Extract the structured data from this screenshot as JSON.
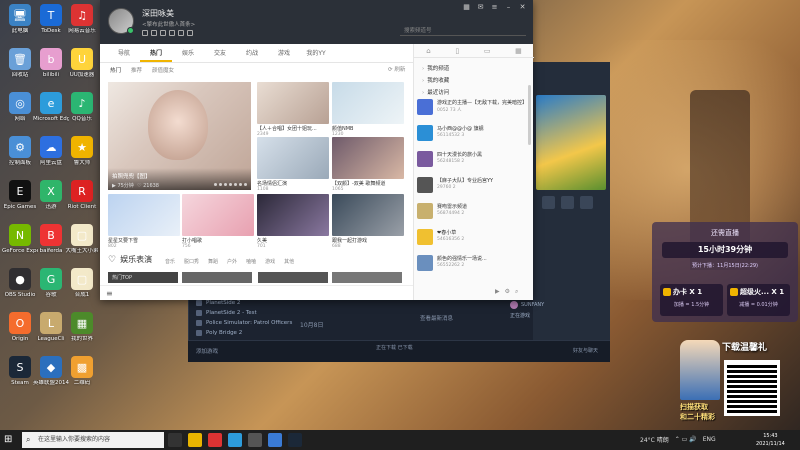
{
  "desktop": {
    "icons": [
      {
        "label": "此电脑",
        "color": "#3b82c4",
        "glyph": "🖥"
      },
      {
        "label": "ToDesk",
        "color": "#1a6ad6",
        "glyph": "T"
      },
      {
        "label": "网易云音乐",
        "color": "#d33",
        "glyph": "♫"
      },
      {
        "label": "回收站",
        "color": "#6aa0d8",
        "glyph": "🗑"
      },
      {
        "label": "bilibili",
        "color": "#e79ecf",
        "glyph": "b"
      },
      {
        "label": "UU加速器",
        "color": "#ffd43b",
        "glyph": "U"
      },
      {
        "label": "网络",
        "color": "#4a8fd6",
        "glyph": "◎"
      },
      {
        "label": "Microsoft Edge",
        "color": "#2d9cdb",
        "glyph": "e"
      },
      {
        "label": "QQ音乐",
        "color": "#2bb673",
        "glyph": "♪"
      },
      {
        "label": "控制面板",
        "color": "#4a8fd6",
        "glyph": "⚙"
      },
      {
        "label": "阿里云盘",
        "color": "#2d6fe0",
        "glyph": "☁"
      },
      {
        "label": "鲁大师",
        "color": "#f0b400",
        "glyph": "★"
      },
      {
        "label": "Epic Games",
        "color": "#111",
        "glyph": "E"
      },
      {
        "label": "迅游",
        "color": "#2fb56a",
        "glyph": "X"
      },
      {
        "label": "Riot Client",
        "color": "#d22",
        "glyph": "R"
      },
      {
        "label": "GeForce Experience",
        "color": "#76b900",
        "glyph": "N"
      },
      {
        "label": "baiferda",
        "color": "#e33",
        "glyph": "B"
      },
      {
        "label": "大嘴王大小弟",
        "color": "#f3e9c9",
        "glyph": "▢"
      },
      {
        "label": "OBS Studio",
        "color": "#302e31",
        "glyph": "●"
      },
      {
        "label": "谷歌",
        "color": "#2bb673",
        "glyph": "G"
      },
      {
        "label": "合成1",
        "color": "#f3e9c9",
        "glyph": "▢"
      },
      {
        "label": "Origin",
        "color": "#f56c2d",
        "glyph": "O"
      },
      {
        "label": "LeagueCli",
        "color": "#c8aa6e",
        "glyph": "L"
      },
      {
        "label": "我的世界",
        "color": "#4c8a2a",
        "glyph": "▦"
      },
      {
        "label": "Steam",
        "color": "#1b2838",
        "glyph": "S"
      },
      {
        "label": "英雄联盟2014",
        "color": "#2b6fbd",
        "glyph": "◆"
      },
      {
        "label": "二维码",
        "color": "#f0a030",
        "glyph": "▩"
      }
    ]
  },
  "yy": {
    "user_name": "深田咏美",
    "signature": "<擎布此世傲人首条>",
    "search_placeholder": "搜索频道号",
    "nav_tabs": [
      "导航",
      "热门",
      "娱乐",
      "交友",
      "约战",
      "游戏",
      "我的YY"
    ],
    "active_tab": "热门",
    "subnav": [
      "热门",
      "推荐",
      "颜值魔女"
    ],
    "refresh_label": "刷新",
    "featured": {
      "title": "拍照兜兜【图】",
      "viewers": "75分钟",
      "count": "21638"
    },
    "tiles": [
      {
        "title": "【人＋合唱】女团十姐玩...",
        "meta": "2349"
      },
      {
        "title": "颜值NMB",
        "meta": "1230"
      },
      {
        "title": "名场情侣汇演",
        "meta": "1108"
      },
      {
        "title": "【双颜】-双美 歌舞频道",
        "meta": "1065"
      },
      {
        "title": "星星又要下雪",
        "meta": "802"
      },
      {
        "title": "打小唱歌",
        "meta": "756"
      },
      {
        "title": "久美",
        "meta": "701"
      },
      {
        "title": "跟我一起打游戏",
        "meta": "688"
      }
    ],
    "section_title": "娱乐表演",
    "section_cats": [
      "音乐",
      "脱口秀",
      "舞蹈",
      "户外",
      "嗑嗑",
      "游戏",
      "其他"
    ],
    "hot_label": "热门TOP",
    "right_links": [
      "我的频道",
      "我的收藏",
      "最近访问"
    ],
    "recent": [
      {
        "name": "游戏正的主播—【无敌下载，完美暗控】",
        "stats": "0052 73 人",
        "color": "#4a6fd6"
      },
      {
        "name": "马小西@@小@ 旗舰",
        "stats": "56114532 3",
        "color": "#2b8fd6"
      },
      {
        "name": "四十天漫长的旅小黑",
        "stats": "56248158 2",
        "color": "#7a5a9e"
      },
      {
        "name": "【麻子大队】专业后宫YY",
        "stats": "29760 2",
        "color": "#555"
      },
      {
        "name": "赛吻雷示频道",
        "stats": "56874494 2",
        "color": "#c8b06e"
      },
      {
        "name": "❤春小草",
        "stats": "54616356 2",
        "color": "#f0c030"
      },
      {
        "name": "颜色的强情乐一场说...",
        "stats": "56552262 2",
        "color": "#6a8fbe"
      }
    ]
  },
  "launcher": {
    "list": [
      "PlanetSide 2",
      "PlanetSide 2 - Test",
      "Police Simulator: Patrol Officers",
      "Poly Bridge 2"
    ],
    "add_game": "添加游戏",
    "downloads": "正在下载\n已下载",
    "empty_text": "查看最新消息",
    "friend": "SUNFANY",
    "friend_status": "正在游戏",
    "friends_chat": "好友与聊天",
    "date_label": "10月8日"
  },
  "live_widget": {
    "header": "还需直播",
    "remaining": "15小时39分钟",
    "next": "预计下播：11月15日(22:29)",
    "cards": [
      {
        "title": "办卡 X 1",
        "sub": "加播 = 1.5分钟"
      },
      {
        "title": "超级火... X 1",
        "sub": "减播 = 0.01分钟"
      }
    ]
  },
  "watermark": {
    "title": "下载温馨礼",
    "sub1": "扫描获取",
    "sub2": "和二十精彩"
  },
  "taskbar": {
    "search_text": "在这里输入你要搜索的内容",
    "tray_weather": "24°C 晴朗",
    "lang": "ENG",
    "time": "15:43",
    "date": "2021/11/14"
  },
  "colors": {
    "accent": "#f0b400",
    "header_bg": "#2b3038"
  }
}
